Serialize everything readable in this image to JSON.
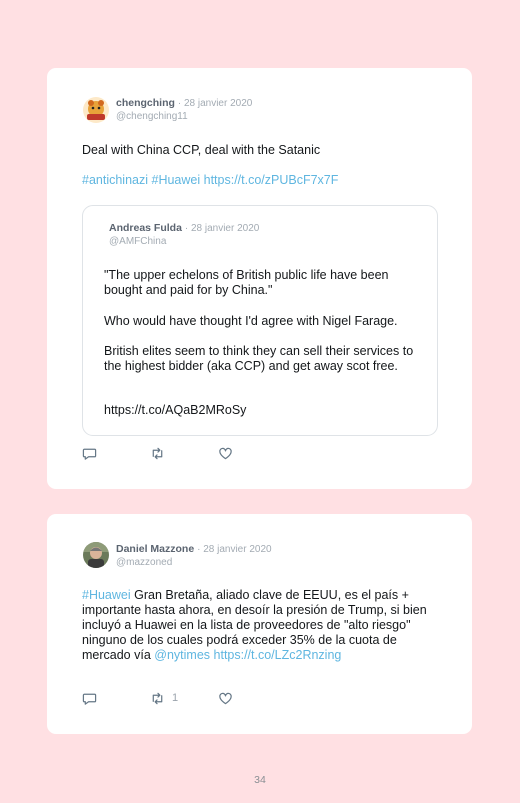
{
  "tweets": [
    {
      "author": "chengching",
      "date": "· 28 janvier 2020",
      "handle": "@chengching11",
      "text_line1": "Deal with China CCP, deal with the Satanic",
      "hashtag1": "#antichinazi",
      "hashtag2": "#Huawei",
      "url": "https://t.co/zPUBcF7x7F",
      "quoted": {
        "author": "Andreas Fulda",
        "date": "· 28 janvier 2020",
        "handle": "@AMFChina",
        "para1": "\"The upper echelons of British public life have been bought and paid for by China.\"",
        "para2": "Who would have thought I'd agree with Nigel Farage.",
        "para3": "British elites seem to think they can sell their services to the highest bidder (aka CCP) and get away scot free.",
        "url": "https://t.co/AQaB2MRoSy"
      }
    },
    {
      "author": "Daniel Mazzone",
      "date": "· 28 janvier 2020",
      "handle": "@mazzoned",
      "hashtag": "#Huawei",
      "text_main": " Gran Bretaña, aliado clave de EEUU, es el país + importante hasta ahora, en desoír la presión de Trump, si bien incluyó a Huawei en la lista de proveedores de \"alto riesgo\" ninguno de los cuales podrá exceder 35% de la cuota de mercado vía ",
      "mention": "@nytimes",
      "url": "https://t.co/LZc2Rnzing",
      "retweet_count": "1"
    }
  ],
  "page_number": "34",
  "icons": [
    "reply-icon",
    "retweet-icon",
    "like-icon"
  ],
  "colors": {
    "background": "#ffe0e3",
    "link": "#5fb6e0",
    "card": "#ffffff"
  }
}
